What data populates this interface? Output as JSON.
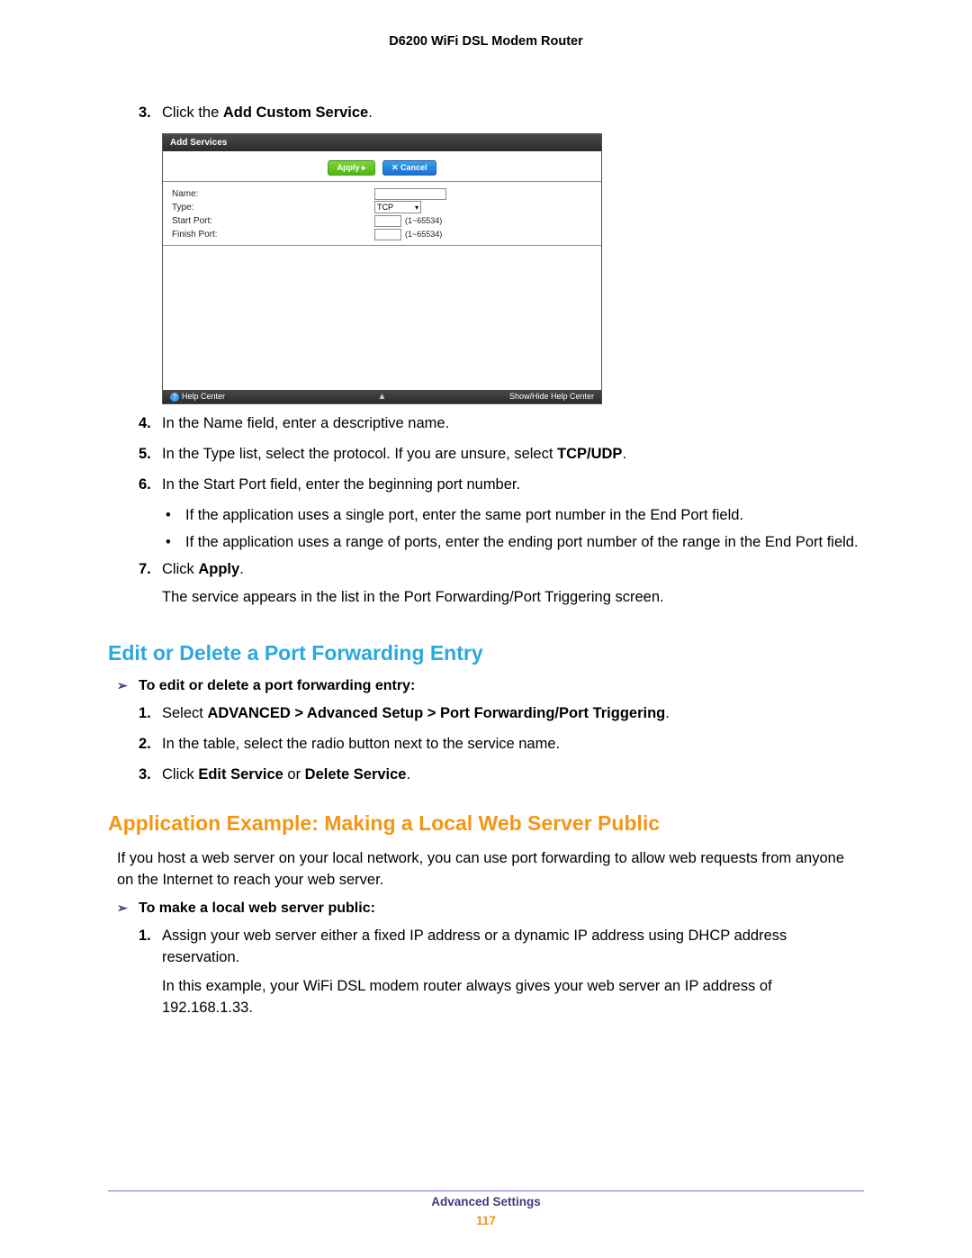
{
  "doc_title": "D6200 WiFi DSL Modem Router",
  "step3": {
    "num": "3.",
    "prefix": "Click the ",
    "bold": "Add Custom Service",
    "suffix": "."
  },
  "screenshot": {
    "title": "Add Services",
    "apply": "Apply ▸",
    "cancel": "✕ Cancel",
    "rows": {
      "name": "Name:",
      "type": "Type:",
      "type_value": "TCP",
      "start": "Start Port:",
      "finish": "Finish Port:",
      "range": "(1~65534)"
    },
    "help_center": "Help Center",
    "show_hide": "Show/Hide Help Center"
  },
  "step4": {
    "num": "4.",
    "text": "In the Name field, enter a descriptive name."
  },
  "step5": {
    "num": "5.",
    "prefix": "In the Type list, select the protocol. If you are unsure, select ",
    "bold": "TCP/UDP",
    "suffix": "."
  },
  "step6": {
    "num": "6.",
    "text": "In the Start Port field, enter the beginning port number."
  },
  "bullet1": "If the application uses a single port, enter the same port number in the End Port field.",
  "bullet2": "If the application uses a range of ports, enter the ending port number of the range in the End Port field.",
  "step7": {
    "num": "7.",
    "prefix": "Click ",
    "bold": "Apply",
    "suffix": ".",
    "after": "The service appears in the list in the Port Forwarding/Port Triggering screen."
  },
  "h2_edit": "Edit or Delete a Port Forwarding Entry",
  "proc_edit": "To edit or delete a port forwarding entry:",
  "edit1": {
    "num": "1.",
    "prefix": "Select ",
    "bold": "ADVANCED > Advanced Setup > Port Forwarding/Port Triggering",
    "suffix": "."
  },
  "edit2": {
    "num": "2.",
    "text": "In the table, select the radio button next to the service name."
  },
  "edit3": {
    "num": "3.",
    "prefix": "Click ",
    "bold1": "Edit Service",
    "mid": " or ",
    "bold2": "Delete Service",
    "suffix": "."
  },
  "h2_app": "Application Example: Making a Local Web Server Public",
  "app_intro": "If you host a web server on your local network, you can use port forwarding to allow web requests from anyone on the Internet to reach your web server.",
  "proc_app": "To make a local web server public:",
  "app1": {
    "num": "1.",
    "text": "Assign your web server either a fixed IP address or a dynamic IP address using DHCP address reservation.",
    "after": "In this example, your WiFi DSL modem router always gives your web server an IP address of 192.168.1.33."
  },
  "footer_section": "Advanced Settings",
  "footer_page": "117"
}
